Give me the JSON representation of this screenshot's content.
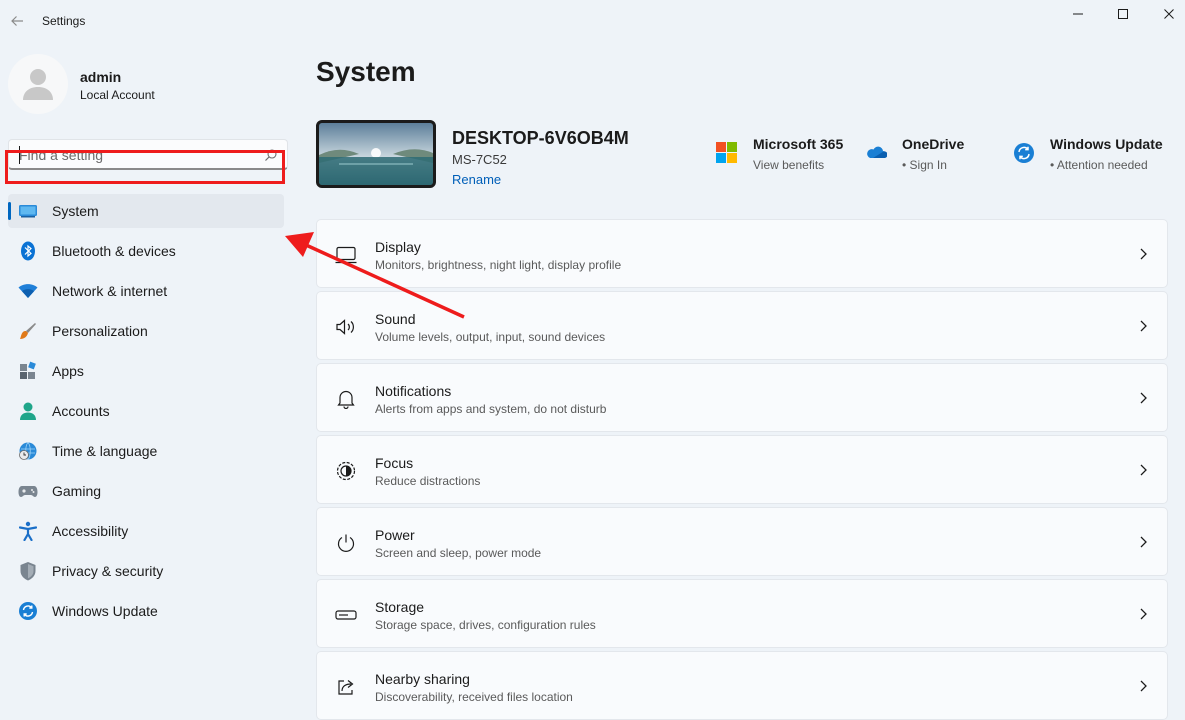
{
  "app": {
    "title": "Settings"
  },
  "window_controls": {
    "minimize": "minimize-icon",
    "maximize": "maximize-icon",
    "close": "close-icon"
  },
  "user": {
    "name": "admin",
    "account_type": "Local Account"
  },
  "search": {
    "placeholder": "Find a setting"
  },
  "sidebar": {
    "items": [
      {
        "label": "System",
        "icon": "system-icon",
        "selected": true
      },
      {
        "label": "Bluetooth & devices",
        "icon": "bluetooth-icon"
      },
      {
        "label": "Network & internet",
        "icon": "wifi-icon"
      },
      {
        "label": "Personalization",
        "icon": "brush-icon"
      },
      {
        "label": "Apps",
        "icon": "apps-icon"
      },
      {
        "label": "Accounts",
        "icon": "accounts-icon"
      },
      {
        "label": "Time & language",
        "icon": "globe-clock-icon"
      },
      {
        "label": "Gaming",
        "icon": "gamepad-icon"
      },
      {
        "label": "Accessibility",
        "icon": "accessibility-icon"
      },
      {
        "label": "Privacy & security",
        "icon": "shield-icon"
      },
      {
        "label": "Windows Update",
        "icon": "update-icon"
      }
    ]
  },
  "main": {
    "title": "System",
    "device": {
      "name": "DESKTOP-6V6OB4M",
      "model": "MS-7C52",
      "rename": "Rename"
    },
    "quick_links": [
      {
        "title": "Microsoft 365",
        "subtitle": "View benefits",
        "icon": "microsoft-logo-icon"
      },
      {
        "title": "OneDrive",
        "subtitle": "Sign In",
        "icon": "onedrive-icon"
      },
      {
        "title": "Windows Update",
        "subtitle": "Attention needed",
        "icon": "windows-update-icon"
      }
    ],
    "cards": [
      {
        "title": "Display",
        "subtitle": "Monitors, brightness, night light, display profile",
        "icon": "display-icon"
      },
      {
        "title": "Sound",
        "subtitle": "Volume levels, output, input, sound devices",
        "icon": "speaker-icon"
      },
      {
        "title": "Notifications",
        "subtitle": "Alerts from apps and system, do not disturb",
        "icon": "bell-icon"
      },
      {
        "title": "Focus",
        "subtitle": "Reduce distractions",
        "icon": "focus-icon"
      },
      {
        "title": "Power",
        "subtitle": "Screen and sleep, power mode",
        "icon": "power-icon"
      },
      {
        "title": "Storage",
        "subtitle": "Storage space, drives, configuration rules",
        "icon": "storage-icon"
      },
      {
        "title": "Nearby sharing",
        "subtitle": "Discoverability, received files location",
        "icon": "share-icon"
      }
    ]
  },
  "colors": {
    "accent": "#0067c0",
    "annotation": "#ee1c1c",
    "background": "#eef3f8"
  }
}
